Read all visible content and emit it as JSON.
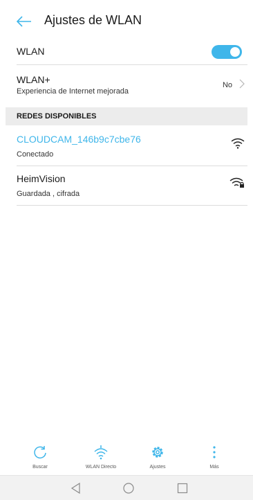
{
  "header": {
    "title": "Ajustes de WLAN",
    "back_icon": "arrow-left-icon"
  },
  "wlan": {
    "label": "WLAN",
    "enabled": true
  },
  "wlan_plus": {
    "label": "WLAN+",
    "subtitle": "Experiencia de Internet mejorada",
    "value": "No"
  },
  "section": {
    "title": "REDES DISPONIBLES"
  },
  "networks": [
    {
      "name": "CLOUDCAM_146b9c7cbe76",
      "status": "Conectado",
      "icon": "wifi-icon",
      "locked": false
    },
    {
      "name": "HeimVision",
      "status": "Guardada , cifrada",
      "icon": "wifi-lock-icon",
      "locked": true
    }
  ],
  "bottom_bar": [
    {
      "label": "Buscar",
      "icon": "refresh-icon"
    },
    {
      "label": "WLAN Directo",
      "icon": "wifi-direct-icon"
    },
    {
      "label": "Ajustes",
      "icon": "gear-icon"
    },
    {
      "label": "Más",
      "icon": "more-vertical-icon"
    }
  ],
  "colors": {
    "accent": "#3fb6ea",
    "divider": "#dcdcdc",
    "section_bg": "#ececec"
  }
}
